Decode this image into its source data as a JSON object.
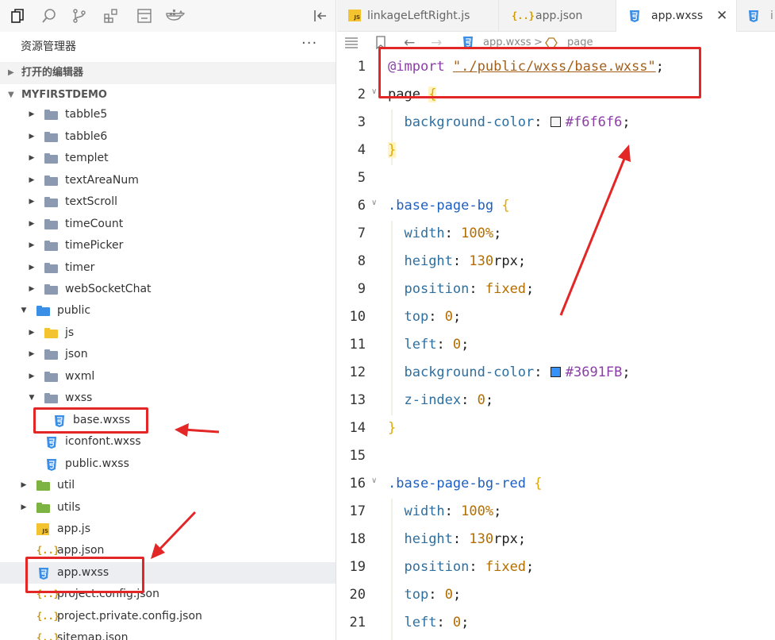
{
  "sidebar": {
    "title": "资源管理器",
    "more": "···",
    "open_editors": "打开的编辑器",
    "project": "MYFIRSTDEMO",
    "tree": [
      {
        "label": "tabble5",
        "kind": "folder",
        "depth": 1,
        "state": "collapsed"
      },
      {
        "label": "tabble6",
        "kind": "folder",
        "depth": 1,
        "state": "collapsed"
      },
      {
        "label": "templet",
        "kind": "folder",
        "depth": 1,
        "state": "collapsed"
      },
      {
        "label": "textAreaNum",
        "kind": "folder",
        "depth": 1,
        "state": "collapsed"
      },
      {
        "label": "textScroll",
        "kind": "folder",
        "depth": 1,
        "state": "collapsed"
      },
      {
        "label": "timeCount",
        "kind": "folder",
        "depth": 1,
        "state": "collapsed"
      },
      {
        "label": "timePicker",
        "kind": "folder",
        "depth": 1,
        "state": "collapsed"
      },
      {
        "label": "timer",
        "kind": "folder",
        "depth": 1,
        "state": "collapsed"
      },
      {
        "label": "webSocketChat",
        "kind": "folder",
        "depth": 1,
        "state": "collapsed"
      },
      {
        "label": "public",
        "kind": "folder-blue",
        "depth": 0,
        "state": "expanded"
      },
      {
        "label": "js",
        "kind": "folder-yellow",
        "depth": 1,
        "state": "collapsed"
      },
      {
        "label": "json",
        "kind": "folder",
        "depth": 1,
        "state": "collapsed"
      },
      {
        "label": "wxml",
        "kind": "folder",
        "depth": 1,
        "state": "collapsed"
      },
      {
        "label": "wxss",
        "kind": "folder",
        "depth": 1,
        "state": "expanded"
      },
      {
        "label": "base.wxss",
        "kind": "css",
        "depth": 2
      },
      {
        "label": "iconfont.wxss",
        "kind": "css",
        "depth": 1
      },
      {
        "label": "public.wxss",
        "kind": "css",
        "depth": 1
      },
      {
        "label": "util",
        "kind": "folder-green",
        "depth": 0,
        "state": "collapsed"
      },
      {
        "label": "utils",
        "kind": "folder-green",
        "depth": 0,
        "state": "collapsed"
      },
      {
        "label": "app.js",
        "kind": "js",
        "depth": 0
      },
      {
        "label": "app.json",
        "kind": "json",
        "depth": 0
      },
      {
        "label": "app.wxss",
        "kind": "css",
        "depth": 0,
        "selected": true
      },
      {
        "label": "project.config.json",
        "kind": "json",
        "depth": 0
      },
      {
        "label": "project.private.config.json",
        "kind": "json",
        "depth": 0
      },
      {
        "label": "sitemap.json",
        "kind": "json",
        "depth": 0
      }
    ]
  },
  "tabs": [
    {
      "label": "linkageLeftRight.js",
      "icon": "js",
      "active": false
    },
    {
      "label": "app.json",
      "icon": "json",
      "active": false
    },
    {
      "label": "app.wxss",
      "icon": "css",
      "active": true
    },
    {
      "label": "i",
      "icon": "css",
      "active": false
    }
  ],
  "breadcrumb": {
    "file": "app.wxss",
    "symbol": "page",
    "separator": ">"
  },
  "colors": {
    "swatch1": "#f6f6f6",
    "swatch2": "#3691FB",
    "annotation": "#e32626"
  },
  "code": [
    {
      "n": "1",
      "fold": "",
      "tokens": [
        {
          "c": "k-at",
          "t": "@import"
        },
        {
          "c": "",
          "t": " "
        },
        {
          "c": "k-str",
          "t": "\"./public/wxss/base.wxss\""
        },
        {
          "c": "",
          "t": ";"
        }
      ]
    },
    {
      "n": "2",
      "fold": "∨",
      "tokens": [
        {
          "c": "",
          "t": "page "
        },
        {
          "c": "k-brace2",
          "t": "{"
        }
      ]
    },
    {
      "n": "3",
      "fold": "",
      "tokens": [
        {
          "c": "",
          "t": "  "
        },
        {
          "c": "k-prop",
          "t": "background-color"
        },
        {
          "c": "",
          "t": ": "
        },
        {
          "c": "sw1",
          "t": ""
        },
        {
          "c": "k-hex",
          "t": "#f6f6f6"
        },
        {
          "c": "",
          "t": ";"
        }
      ]
    },
    {
      "n": "4",
      "fold": "",
      "tokens": [
        {
          "c": "k-brace2",
          "t": "}"
        }
      ]
    },
    {
      "n": "5",
      "fold": "",
      "tokens": []
    },
    {
      "n": "6",
      "fold": "∨",
      "tokens": [
        {
          "c": "k-sel",
          "t": ".base-page-bg"
        },
        {
          "c": "",
          "t": " "
        },
        {
          "c": "k-brace",
          "t": "{"
        }
      ]
    },
    {
      "n": "7",
      "fold": "",
      "tokens": [
        {
          "c": "",
          "t": "  "
        },
        {
          "c": "k-prop",
          "t": "width"
        },
        {
          "c": "",
          "t": ": "
        },
        {
          "c": "k-num",
          "t": "100%"
        },
        {
          "c": "",
          "t": ";"
        }
      ]
    },
    {
      "n": "8",
      "fold": "",
      "tokens": [
        {
          "c": "",
          "t": "  "
        },
        {
          "c": "k-prop",
          "t": "height"
        },
        {
          "c": "",
          "t": ": "
        },
        {
          "c": "k-num",
          "t": "130"
        },
        {
          "c": "",
          "t": "rpx;"
        }
      ]
    },
    {
      "n": "9",
      "fold": "",
      "tokens": [
        {
          "c": "",
          "t": "  "
        },
        {
          "c": "k-prop",
          "t": "position"
        },
        {
          "c": "",
          "t": ": "
        },
        {
          "c": "k-num",
          "t": "fixed"
        },
        {
          "c": "",
          "t": ";"
        }
      ]
    },
    {
      "n": "10",
      "fold": "",
      "tokens": [
        {
          "c": "",
          "t": "  "
        },
        {
          "c": "k-prop",
          "t": "top"
        },
        {
          "c": "",
          "t": ": "
        },
        {
          "c": "k-num",
          "t": "0"
        },
        {
          "c": "",
          "t": ";"
        }
      ]
    },
    {
      "n": "11",
      "fold": "",
      "tokens": [
        {
          "c": "",
          "t": "  "
        },
        {
          "c": "k-prop",
          "t": "left"
        },
        {
          "c": "",
          "t": ": "
        },
        {
          "c": "k-num",
          "t": "0"
        },
        {
          "c": "",
          "t": ";"
        }
      ]
    },
    {
      "n": "12",
      "fold": "",
      "tokens": [
        {
          "c": "",
          "t": "  "
        },
        {
          "c": "k-prop",
          "t": "background-color"
        },
        {
          "c": "",
          "t": ": "
        },
        {
          "c": "sw2",
          "t": ""
        },
        {
          "c": "k-hex",
          "t": "#3691FB"
        },
        {
          "c": "",
          "t": ";"
        }
      ]
    },
    {
      "n": "13",
      "fold": "",
      "tokens": [
        {
          "c": "",
          "t": "  "
        },
        {
          "c": "k-prop",
          "t": "z-index"
        },
        {
          "c": "",
          "t": ": "
        },
        {
          "c": "k-num",
          "t": "0"
        },
        {
          "c": "",
          "t": ";"
        }
      ]
    },
    {
      "n": "14",
      "fold": "",
      "tokens": [
        {
          "c": "k-brace",
          "t": "}"
        }
      ]
    },
    {
      "n": "15",
      "fold": "",
      "tokens": []
    },
    {
      "n": "16",
      "fold": "∨",
      "tokens": [
        {
          "c": "k-sel",
          "t": ".base-page-bg-red"
        },
        {
          "c": "",
          "t": " "
        },
        {
          "c": "k-brace",
          "t": "{"
        }
      ]
    },
    {
      "n": "17",
      "fold": "",
      "tokens": [
        {
          "c": "",
          "t": "  "
        },
        {
          "c": "k-prop",
          "t": "width"
        },
        {
          "c": "",
          "t": ": "
        },
        {
          "c": "k-num",
          "t": "100%"
        },
        {
          "c": "",
          "t": ";"
        }
      ]
    },
    {
      "n": "18",
      "fold": "",
      "tokens": [
        {
          "c": "",
          "t": "  "
        },
        {
          "c": "k-prop",
          "t": "height"
        },
        {
          "c": "",
          "t": ": "
        },
        {
          "c": "k-num",
          "t": "130"
        },
        {
          "c": "",
          "t": "rpx;"
        }
      ]
    },
    {
      "n": "19",
      "fold": "",
      "tokens": [
        {
          "c": "",
          "t": "  "
        },
        {
          "c": "k-prop",
          "t": "position"
        },
        {
          "c": "",
          "t": ": "
        },
        {
          "c": "k-num",
          "t": "fixed"
        },
        {
          "c": "",
          "t": ";"
        }
      ]
    },
    {
      "n": "20",
      "fold": "",
      "tokens": [
        {
          "c": "",
          "t": "  "
        },
        {
          "c": "k-prop",
          "t": "top"
        },
        {
          "c": "",
          "t": ": "
        },
        {
          "c": "k-num",
          "t": "0"
        },
        {
          "c": "",
          "t": ";"
        }
      ]
    },
    {
      "n": "21",
      "fold": "",
      "tokens": [
        {
          "c": "",
          "t": "  "
        },
        {
          "c": "k-prop",
          "t": "left"
        },
        {
          "c": "",
          "t": ": "
        },
        {
          "c": "k-num",
          "t": "0"
        },
        {
          "c": "",
          "t": ";"
        }
      ]
    }
  ]
}
